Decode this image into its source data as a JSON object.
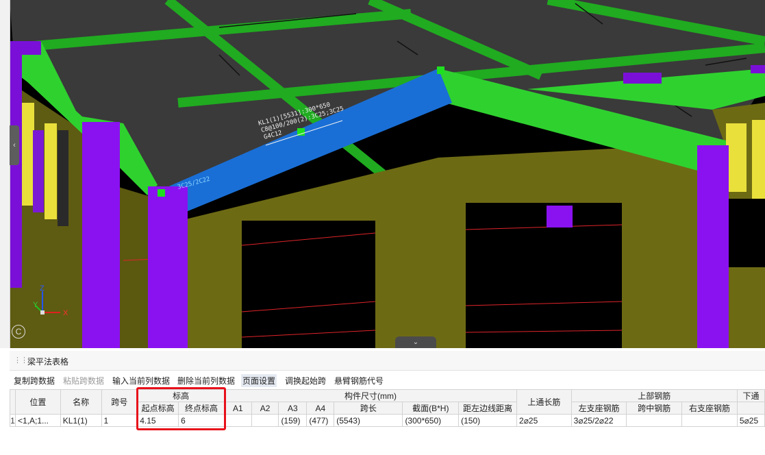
{
  "viewport": {
    "labels": {
      "annotation_main": "KL1(1)[5531]:300*650",
      "annotation_line2": "C8@100/200(2):3C25;3C25",
      "annotation_line3": "G4C12",
      "annotation_start": "3C25/2C22",
      "axis_z": "Z",
      "axis_y": "Y",
      "axis_x": "X",
      "axis_c": "C"
    },
    "colors": {
      "beam_green": "#2fd12f",
      "beam_selected": "#1a6fd6",
      "column_purple": "#8a12f0",
      "wall_olive": "#6d6a14",
      "slab": "#3c3c3c",
      "handle": "#1fe01f",
      "rebar_red": "#e0242a"
    }
  },
  "panel": {
    "title": "梁平法表格",
    "toolbar": {
      "copy_span": "复制跨数据",
      "paste_span": "粘贴跨数据",
      "input_col": "输入当前列数据",
      "delete_col": "删除当前列数据",
      "page_setup": "页面设置",
      "swap_span": "调换起始跨",
      "cantilever_code": "悬臂钢筋代号"
    },
    "headers": {
      "position": "位置",
      "name": "名称",
      "span_no": "跨号",
      "elevation": "标高",
      "start_elev": "起点标高",
      "end_elev": "终点标高",
      "dimensions": "构件尺寸(mm)",
      "a1": "A1",
      "a2": "A2",
      "a3": "A3",
      "a4": "A4",
      "span_len": "跨长",
      "section": "截面(B*H)",
      "edge_dist": "距左边线距离",
      "top_cont": "上通长筋",
      "top_rebar": "上部钢筋",
      "left_support": "左支座钢筋",
      "mid_span": "跨中钢筋",
      "right_support": "右支座钢筋",
      "bottom_prefix": "下通"
    },
    "rows": [
      {
        "row_no": "1",
        "position": "<1,A;1...",
        "name": "KL1(1)",
        "span_no": "1",
        "start_elev": "4.15",
        "end_elev": "6",
        "a1": "",
        "a2": "",
        "a3": "(159)",
        "a4": "(477)",
        "span_len": "(5543)",
        "section": "(300*650)",
        "edge_dist": "(150)",
        "top_cont": "2⌀25",
        "left_support": "3⌀25/2⌀22",
        "mid_span": "",
        "right_support": "",
        "bottom": "5⌀25"
      }
    ]
  }
}
